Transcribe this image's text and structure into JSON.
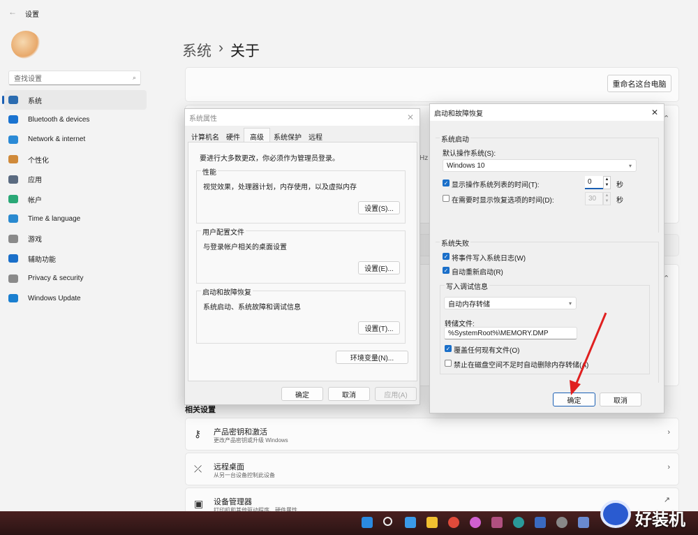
{
  "window": {
    "title": "设置",
    "back_icon": "back-arrow-icon"
  },
  "search": {
    "placeholder": "查找设置"
  },
  "sidebar": {
    "items": [
      {
        "label": "系统",
        "icon": "system-icon",
        "color": "#2b6cb0",
        "active": true
      },
      {
        "label": "Bluetooth & devices",
        "icon": "bluetooth-icon",
        "color": "#1a73d0"
      },
      {
        "label": "Network & internet",
        "icon": "wifi-icon",
        "color": "#2b8ad6"
      },
      {
        "label": "个性化",
        "icon": "brush-icon",
        "color": "#d08a3a"
      },
      {
        "label": "应用",
        "icon": "apps-icon",
        "color": "#5a6a80"
      },
      {
        "label": "帐户",
        "icon": "account-icon",
        "color": "#2aa876"
      },
      {
        "label": "Time & language",
        "icon": "globe-clock-icon",
        "color": "#2a8ad0"
      },
      {
        "label": "游戏",
        "icon": "gamepad-icon",
        "color": "#8a8a8a"
      },
      {
        "label": "辅助功能",
        "icon": "accessibility-icon",
        "color": "#1a6fc9"
      },
      {
        "label": "Privacy & security",
        "icon": "shield-icon",
        "color": "#8a8a8a"
      },
      {
        "label": "Windows Update",
        "icon": "update-icon",
        "color": "#1a7fd0"
      }
    ]
  },
  "breadcrumb": {
    "parent": "系统",
    "separator": "›",
    "current": "关于"
  },
  "rename_button": "重命名这台电脑",
  "partial_text": "Hz",
  "related": {
    "title": "相关设置",
    "items": [
      {
        "title": "产品密钥和激活",
        "subtitle": "更改产品密钥或升级 Windows",
        "icon": "key-icon",
        "action": "chevron-right-icon"
      },
      {
        "title": "远程桌面",
        "subtitle": "从另一台设备控制此设备",
        "icon": "remote-desktop-icon",
        "action": "chevron-right-icon"
      },
      {
        "title": "设备管理器",
        "subtitle": "打印机和其他驱动程序、硬件属性",
        "icon": "device-manager-icon",
        "action": "external-link-icon"
      }
    ]
  },
  "sysprop": {
    "title": "系统属性",
    "tabs": [
      "计算机名",
      "硬件",
      "高级",
      "系统保护",
      "远程"
    ],
    "active_tab": "高级",
    "notice": "要进行大多数更改，你必须作为管理员登录。",
    "groups": [
      {
        "title": "性能",
        "desc": "视觉效果，处理器计划，内存使用，以及虚拟内存",
        "button": "设置(S)..."
      },
      {
        "title": "用户配置文件",
        "desc": "与登录帐户相关的桌面设置",
        "button": "设置(E)..."
      },
      {
        "title": "启动和故障恢复",
        "desc": "系统启动、系统故障和调试信息",
        "button": "设置(T)..."
      }
    ],
    "env_button": "环境变量(N)...",
    "ok": "确定",
    "cancel": "取消",
    "apply": "应用(A)"
  },
  "startup": {
    "title": "启动和故障恢复",
    "boot_group": "系统启动",
    "default_os_label": "默认操作系统(S):",
    "default_os": "Windows 10",
    "show_list": {
      "label": "显示操作系统列表的时间(T):",
      "checked": true,
      "value": "0",
      "unit": "秒"
    },
    "show_recovery": {
      "label": "在需要时显示恢复选项的时间(D):",
      "checked": false,
      "value": "30",
      "unit": "秒"
    },
    "failure_group": "系统失败",
    "write_event": {
      "label": "将事件写入系统日志(W)",
      "checked": true
    },
    "auto_restart": {
      "label": "自动重新启动(R)",
      "checked": true
    },
    "debug_group": "写入调试信息",
    "debug_type": "自动内存转储",
    "dump_file_label": "转储文件:",
    "dump_file": "%SystemRoot%\\MEMORY.DMP",
    "overwrite": {
      "label": "覆盖任何现有文件(O)",
      "checked": true
    },
    "disable_auto_delete": {
      "label": "禁止在磁盘空间不足时自动删除内存转储(A)",
      "checked": false
    },
    "ok": "确定",
    "cancel": "取消",
    "annotation_color": "#e02020"
  },
  "taskbar": {
    "icons": [
      "start-icon",
      "search-icon",
      "task-view-icon",
      "file-explorer-icon",
      "chrome-icon",
      "color-app-icon",
      "app-icon",
      "edge-icon",
      "photos-icon",
      "settings-icon",
      "system-properties-icon"
    ]
  },
  "watermark": "好装机"
}
